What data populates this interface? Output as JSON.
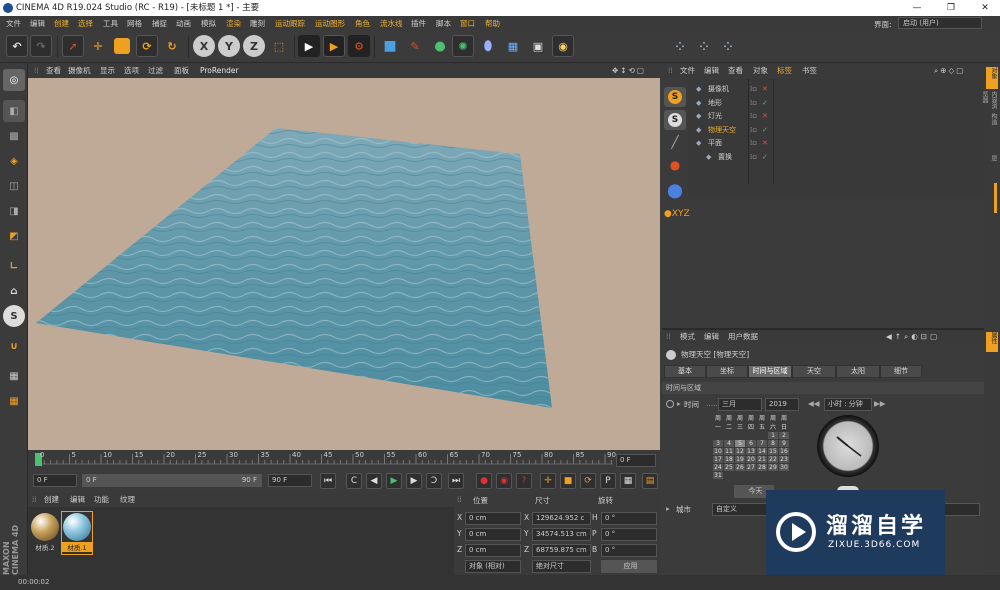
{
  "window": {
    "title": "CINEMA 4D R19.024 Studio (RC - R19) - [未标题 1 *] - 主要",
    "min": "—",
    "max": "❐",
    "close": "✕"
  },
  "menubar": [
    "文件",
    "编辑",
    "创建",
    "选择",
    "工具",
    "网格",
    "捕捉",
    "动画",
    "模拟",
    "渲染",
    "雕刻",
    "运动跟踪",
    "运动图形",
    "角色",
    "流水线",
    "插件",
    "脚本",
    "窗口",
    "帮助"
  ],
  "layout": {
    "label": "界面:",
    "value": "启动 (用户)"
  },
  "viewport": {
    "menu": [
      "查看",
      "摄像机",
      "显示",
      "选项",
      "过滤",
      "面板",
      "ProRender"
    ]
  },
  "timeline": {
    "ticks": [
      "0",
      "5",
      "10",
      "15",
      "20",
      "25",
      "30",
      "35",
      "40",
      "45",
      "50",
      "55",
      "60",
      "65",
      "70",
      "75",
      "80",
      "85",
      "90"
    ],
    "current": "0 F",
    "start": "0 F",
    "slider_start": "0 F",
    "slider_end": "90 F",
    "end": "90 F"
  },
  "materials": {
    "menu": [
      "创建",
      "编辑",
      "功能",
      "纹理"
    ],
    "items": [
      "材质.2",
      "材质.1"
    ]
  },
  "coords": {
    "headers": [
      "位置",
      "尺寸",
      "旋转"
    ],
    "rows": [
      {
        "axis": "X",
        "pos": "0 cm",
        "size": "129624.952 c",
        "rl": "H",
        "rot": "0 °"
      },
      {
        "axis": "Y",
        "pos": "0 cm",
        "size": "34574.513 cm",
        "rl": "P",
        "rot": "0 °"
      },
      {
        "axis": "Z",
        "pos": "0 cm",
        "size": "68759.875 cm",
        "rl": "B",
        "rot": "0 °"
      }
    ],
    "mode": "对象 (相对)",
    "sizemode": "绝对尺寸",
    "apply": "应用"
  },
  "status": {
    "time": "00:00:02"
  },
  "objects": {
    "menu": [
      "文件",
      "编辑",
      "查看",
      "对象",
      "标签",
      "书签"
    ],
    "items": [
      {
        "name": "摄像机",
        "indent": 0,
        "color": "#cfcfcf"
      },
      {
        "name": "地形",
        "indent": 0,
        "color": "#cfcfcf"
      },
      {
        "name": "灯光",
        "indent": 0,
        "color": "#cfcfcf"
      },
      {
        "name": "物理天空",
        "indent": 0,
        "color": "#f0b030"
      },
      {
        "name": "平面",
        "indent": 0,
        "color": "#cfcfcf"
      },
      {
        "name": "置换",
        "indent": 1,
        "color": "#cfcfcf"
      }
    ]
  },
  "attributes": {
    "menu": [
      "模式",
      "编辑",
      "用户数据"
    ],
    "object": "物理天空 [物理天空]",
    "tabs": [
      "基本",
      "坐标",
      "时间与区域",
      "天空",
      "太阳",
      "细节"
    ],
    "section": "时间与区域",
    "time_label": "时间",
    "month": "三月",
    "year": "2019",
    "clock_mode": "小时 : 分钟",
    "weekdays": [
      "周一",
      "周二",
      "周三",
      "周四",
      "周五",
      "周六",
      "周日"
    ],
    "today": "今天",
    "city_label": "城市",
    "city_value": "自定义"
  },
  "right_tabs": [
    "对象",
    "内容浏览器",
    "构造",
    "属性",
    "层"
  ],
  "watermark": {
    "brand": "溜溜自学",
    "url": "ZIXUE.3D66.COM"
  },
  "left_brand": "MAXON CINEMA 4D"
}
